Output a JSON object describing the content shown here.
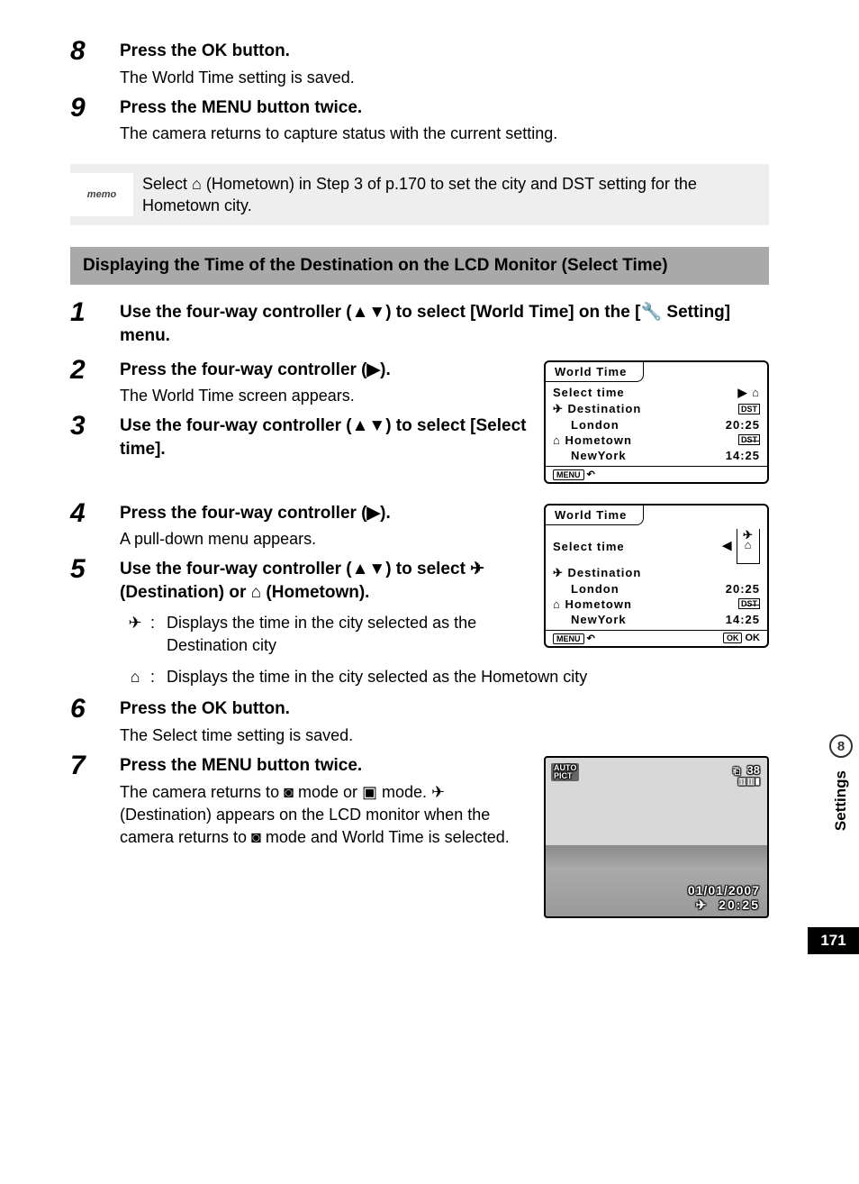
{
  "steps_top": [
    {
      "num": "8",
      "title_pre": "Press the ",
      "title_key": "OK",
      "title_post": " button.",
      "desc": "The World Time setting is saved."
    },
    {
      "num": "9",
      "title_pre": "Press the ",
      "title_key": "MENU",
      "title_post": " button twice.",
      "desc": "The camera returns to capture status with the current setting."
    }
  ],
  "memo": {
    "label": "memo",
    "text_pre": "Select ",
    "text_mid": " (Hometown) in Step 3 of p.170 to set the city and DST setting for the Hometown city."
  },
  "section_title": "Displaying the Time of the Destination on the LCD Monitor (Select Time)",
  "step1": {
    "num": "1",
    "title": "Use the four-way controller (▲▼) to select [World Time] on the [🔧 Setting] menu."
  },
  "step2": {
    "num": "2",
    "title": "Press the four-way controller (▶).",
    "desc": "The World Time screen appears."
  },
  "step3": {
    "num": "3",
    "title": "Use the four-way controller (▲▼) to select [Select time]."
  },
  "step4": {
    "num": "4",
    "title": "Press the four-way controller (▶).",
    "desc": "A pull-down menu appears."
  },
  "step5": {
    "num": "5",
    "title": "Use the four-way controller (▲▼) to select ✈ (Destination) or ⌂ (Hometown).",
    "dest_desc": "Displays the time in the city selected as the Destination city",
    "home_desc": "Displays the time in the city selected as the Hometown city"
  },
  "step6": {
    "num": "6",
    "title_pre": "Press the ",
    "title_key": "OK",
    "title_post": " button.",
    "desc": "The Select time setting is saved."
  },
  "step7": {
    "num": "7",
    "title_pre": "Press the ",
    "title_key": "MENU",
    "title_post": " button twice.",
    "desc": "The camera returns to ◙ mode or ▣ mode. ✈ (Destination) appears on the LCD monitor when the camera returns to ◙ mode and World Time is selected."
  },
  "screen1": {
    "title": "World Time",
    "select_label": "Select time",
    "select_arrow": "▶ ⌂",
    "dest_label": "✈ Destination",
    "dest_city": "London",
    "dest_dst": "DST",
    "dest_time": "20:25",
    "home_label": "⌂ Hometown",
    "home_city": "NewYork",
    "home_dst": "D̶S̶T̶",
    "home_time": "14:25",
    "menu": "MENU",
    "back": "↶"
  },
  "screen2": {
    "title": "World Time",
    "select_label": "Select time",
    "dest_label": "✈ Destination",
    "dest_city": "London",
    "dest_time": "20:25",
    "home_label": "⌂ Hometown",
    "home_city": "NewYork",
    "home_dst": "D̶S̶T̶",
    "home_time": "14:25",
    "menu": "MENU",
    "back": "↶",
    "ok": "OK",
    "ok2": "OK"
  },
  "preview": {
    "mode": "AUTO\nPICT",
    "count": "38",
    "date": "01/01/2007",
    "time": "20:25"
  },
  "side": {
    "chapter": "8",
    "label": "Settings"
  },
  "page_number": "171"
}
